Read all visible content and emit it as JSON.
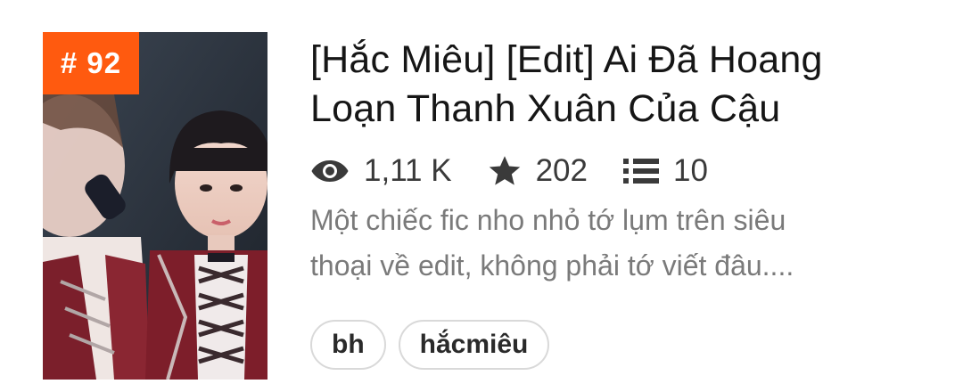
{
  "story": {
    "rank": "# 92",
    "title_line1": "[Hắc Miêu] [Edit] Ai Đã Hoang",
    "title_line2": "Loạn Thanh Xuân Của Cậu",
    "stats": {
      "reads": "1,11 K",
      "votes": "202",
      "parts": "10"
    },
    "description_line1": "Một chiếc fic nho nhỏ tớ lụm trên siêu",
    "description_line2": "thoại về edit, không phải tớ viết đâu....",
    "tags": [
      "bh",
      "hắcmiêu"
    ]
  },
  "colors": {
    "rank_badge": "#ff5a0f",
    "title_text": "#161616",
    "stats_text": "#3a3a3a",
    "description_text": "#7a7a7a",
    "tag_border": "#d9d9d9"
  },
  "icons": {
    "reads": "eye-icon",
    "votes": "star-icon",
    "parts": "list-icon"
  }
}
